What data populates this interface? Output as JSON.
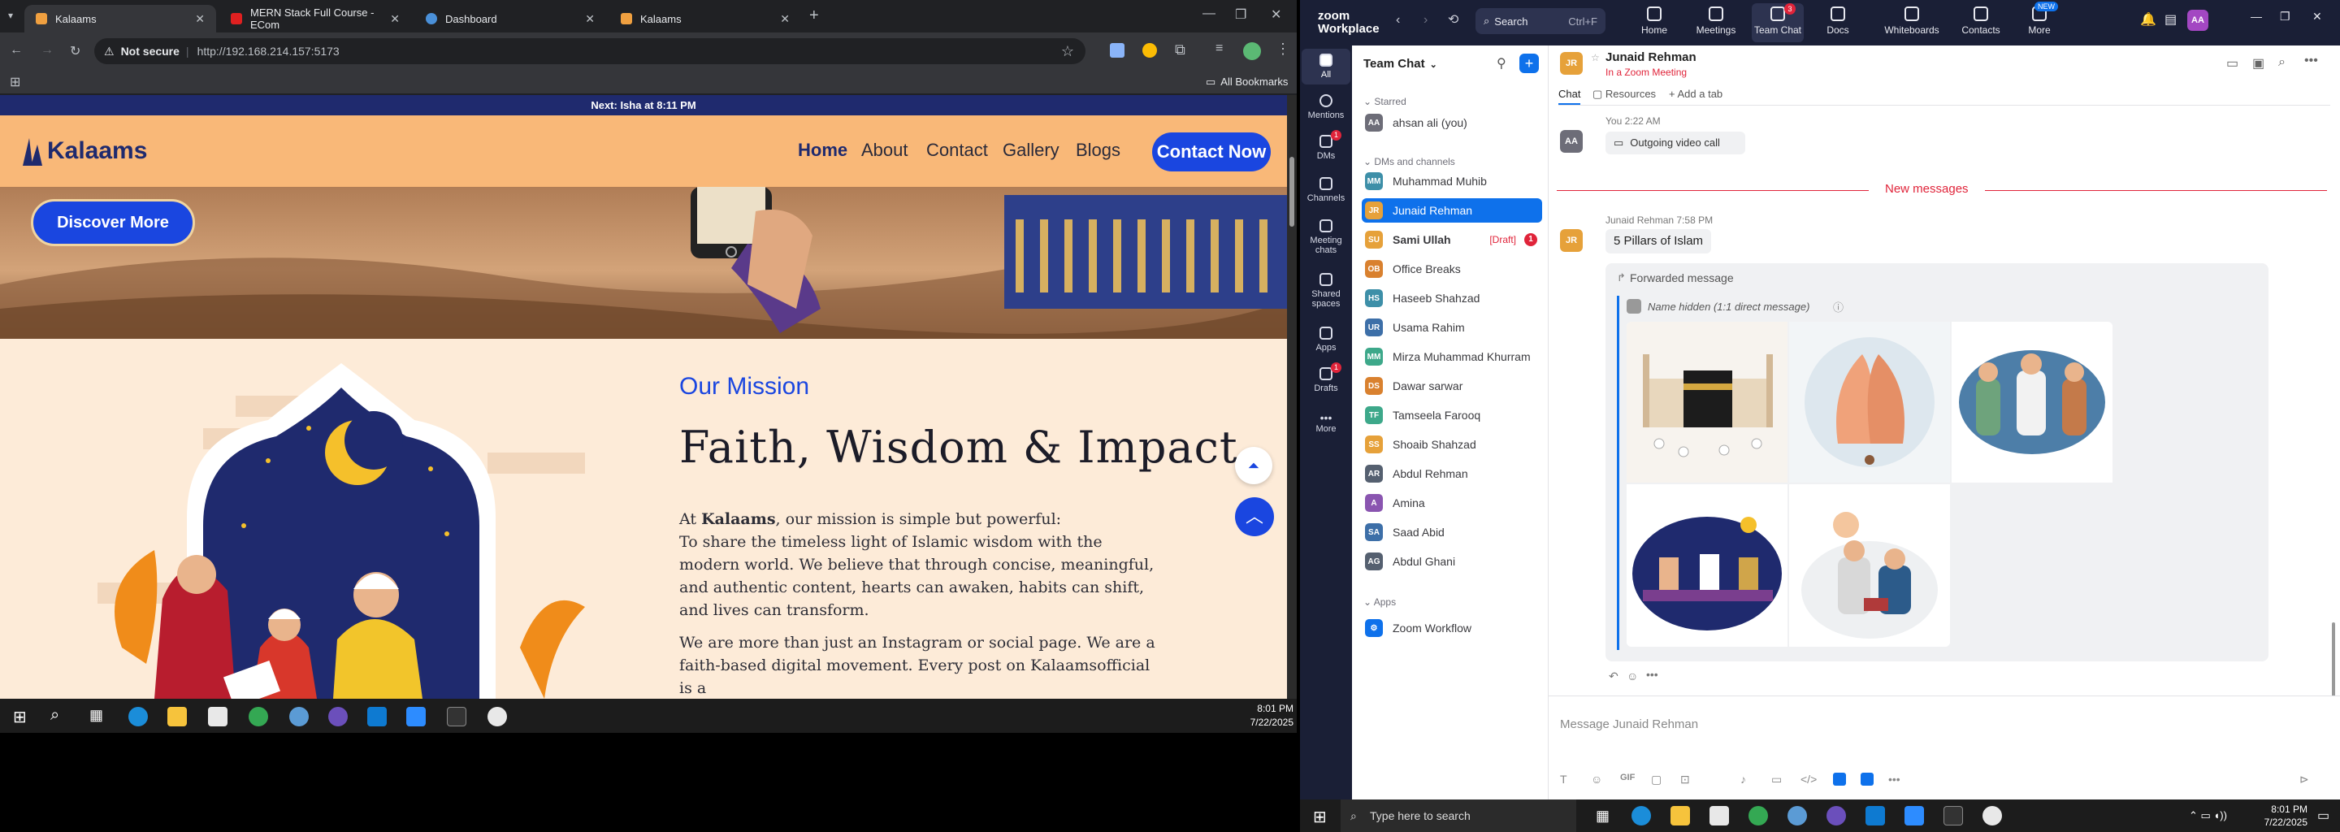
{
  "browser": {
    "tabs": [
      {
        "title": "Kalaams",
        "active": true
      },
      {
        "title": "MERN Stack Full Course - ECom",
        "active": false
      },
      {
        "title": "Dashboard",
        "active": false
      },
      {
        "title": "Kalaams",
        "active": false
      }
    ],
    "security": "Not secure",
    "url": "http://192.168.214.157:5173",
    "all_bookmarks": "All Bookmarks"
  },
  "site": {
    "prayer_bar": "Next: Isha at 8:11 PM",
    "logo": "Kalaams",
    "nav": [
      "Home",
      "About",
      "Contact",
      "Gallery",
      "Blogs"
    ],
    "contact_button": "Contact Now",
    "discover_button": "Discover More",
    "mission_kicker": "Our Mission",
    "mission_title": "Faith, Wisdom & Impact",
    "para1_lead": "At ",
    "para1_brand": "Kalaams",
    "para1_rest": ", our mission is simple but powerful:",
    "para1_body": "To share the timeless light of Islamic wisdom with the modern world. We believe that through concise, meaningful, and authentic content, hearts can awaken, habits can shift, and lives can transform.",
    "para2": "We are more than just an Instagram or social page. We are a faith-based digital movement. Every post on Kalaamsofficial is a"
  },
  "left_clock": {
    "time": "8:01 PM",
    "date": "7/22/2025"
  },
  "zoom": {
    "brand": "zoom Workplace",
    "search": "Search",
    "search_shortcut": "Ctrl+F",
    "top_nav": [
      "Home",
      "Meetings",
      "Team Chat",
      "Docs",
      "Whiteboards",
      "Contacts",
      "More"
    ],
    "team_chat_badge": "3",
    "more_badge": "NEW",
    "avatar_initials": "AA",
    "sidebar": [
      "All",
      "Mentions",
      "DMs",
      "Channels",
      "Meeting chats",
      "Shared spaces",
      "Apps",
      "Drafts",
      "More"
    ],
    "dms_badge": "1",
    "drafts_badge": "1",
    "panel_title": "Team Chat",
    "starred_label": "Starred",
    "starred": [
      {
        "name": "ahsan ali (you)",
        "initials": "AA",
        "color": "#6d6d78"
      }
    ],
    "dm_section": "DMs and channels",
    "contacts": [
      {
        "name": "Muhammad Muhib",
        "initials": "MM",
        "color": "#3d8fa8"
      },
      {
        "name": "Junaid Rehman",
        "initials": "JR",
        "color": "#e6a13a"
      },
      {
        "name": "Sami Ullah",
        "initials": "SU",
        "color": "#e6a13a"
      },
      {
        "name": "Office Breaks",
        "initials": "OB",
        "color": "#d9812f"
      },
      {
        "name": "Haseeb Shahzad",
        "initials": "HS",
        "color": "#3d8fa8"
      },
      {
        "name": "Usama Rahim",
        "initials": "UR",
        "color": "#3d6fa8"
      },
      {
        "name": "Mirza Muhammad Khurram",
        "initials": "MM",
        "color": "#3da88a"
      },
      {
        "name": "Dawar sarwar",
        "initials": "DS",
        "color": "#d9812f"
      },
      {
        "name": "Tamseela Farooq",
        "initials": "TF",
        "color": "#3da88a"
      },
      {
        "name": "Shoaib Shahzad",
        "initials": "SS",
        "color": "#e6a13a"
      },
      {
        "name": "Abdul Rehman",
        "initials": "AR",
        "color": "#556070"
      },
      {
        "name": "Amina",
        "initials": "A",
        "color": "#8a55b0"
      },
      {
        "name": "Saad Abid",
        "initials": "SA",
        "color": "#3d6fa8"
      },
      {
        "name": "Abdul Ghani",
        "initials": "AG",
        "color": "#556070"
      }
    ],
    "sami_draft": "[Draft]",
    "sami_badge": "1",
    "apps_section": "Apps",
    "apps": [
      {
        "name": "Zoom Workflow"
      }
    ],
    "chat_header": {
      "name": "Junaid Rehman",
      "status": "In a Zoom Meeting",
      "initials": "JR"
    },
    "chat_tabs": [
      "Chat",
      "Resources",
      "Add a tab"
    ],
    "msg1": {
      "meta": "You 2:22 AM",
      "text": "Outgoing video call",
      "initials": "AA"
    },
    "new_messages": "New messages",
    "msg2": {
      "meta": "Junaid Rehman 7:58 PM",
      "text": "5 Pillars of Islam",
      "initials": "JR"
    },
    "forwarded_label": "Forwarded message",
    "forwarded_source": "Name hidden (1:1 direct message)",
    "images": [
      "kaaba-illustration",
      "praying-hands-illustration",
      "charity-illustration",
      "ramadan-iftar-illustration",
      "quran-reading-illustration"
    ],
    "composer_placeholder": "Message Junaid Rehman"
  },
  "right_taskbar": {
    "search_placeholder": "Type here to search",
    "time": "8:01 PM",
    "date": "7/22/2025"
  }
}
